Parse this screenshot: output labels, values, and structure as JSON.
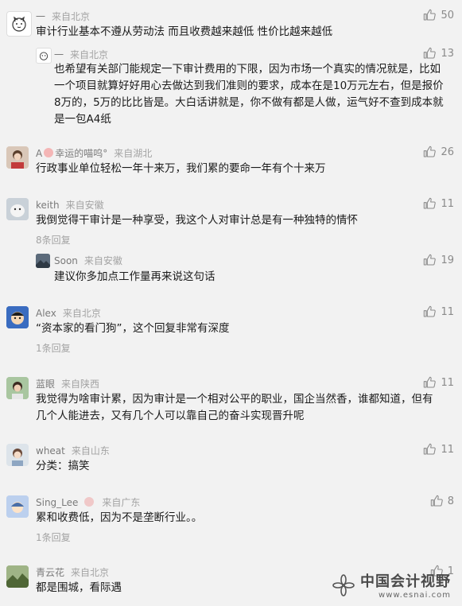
{
  "comments": [
    {
      "name": "一",
      "loc": "来自北京",
      "likes": "50",
      "text": "审计行业基本不遵从劳动法 而且收费越来越低 性价比越来越低"
    },
    {
      "name": "一",
      "loc": "来自北京",
      "likes": "13",
      "text": "也希望有关部门能规定一下审计费用的下限，因为市场一个真实的情况就是，比如一个项目就算好好用心去做达到我们准则的要求，成本在是10万元左右，但是报价8万的，5万的比比皆是。大白话讲就是，你不做有都是人做，运气好不查到成本就是一包A4纸"
    },
    {
      "name": "A",
      "name_suffix": "幸运的喵呜°",
      "loc": "来自湖北",
      "likes": "26",
      "text": "行政事业单位轻松一年十来万，我们累的要命一年有个十来万"
    },
    {
      "name": "keith",
      "loc": "来自安徽",
      "likes": "11",
      "text": "我倒觉得干审计是一种享受，我这个人对审计总是有一种独特的情怀",
      "replies": "8条回复"
    },
    {
      "name": "Soon",
      "loc": "来自安徽",
      "likes": "19",
      "text": "建议你多加点工作量再来说这句话"
    },
    {
      "name": "Alex",
      "loc": "来自北京",
      "likes": "11",
      "text": "“资本家的看门狗”，这个回复非常有深度",
      "replies": "1条回复"
    },
    {
      "name": "蓝眼",
      "loc": "来自陕西",
      "likes": "11",
      "text": "我觉得为啥审计累，因为审计是一个相对公平的职业，国企当然香，谁都知道，但有几个人能进去，又有几个人可以靠自己的奋斗实现晋升呢"
    },
    {
      "name": "wheat",
      "loc": "来自山东",
      "likes": "11",
      "text": "分类：搞笑"
    },
    {
      "name": "Sing_Lee",
      "loc": "来自广东",
      "likes": "8",
      "text": "累和收费低，因为不是垄断行业。。",
      "replies": "1条回复"
    },
    {
      "name": "青云花",
      "loc": "来自北京",
      "likes": "1",
      "text": "都是围城，看际遇"
    }
  ],
  "watermark": {
    "title": "中国会计视野",
    "url": "www.esnai.com"
  },
  "icons": {
    "like": "thumbs-up-icon",
    "accent": "#8a8a8a"
  }
}
